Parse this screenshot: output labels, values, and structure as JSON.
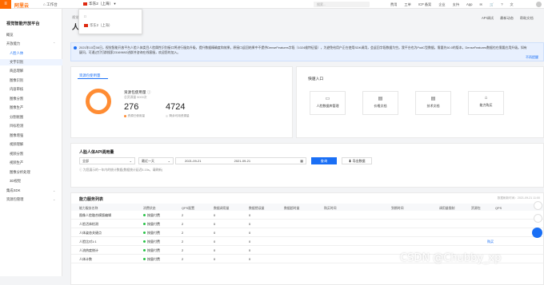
{
  "topbar": {
    "brand": "阿里云",
    "workbench": "工作台",
    "region": "华东2（上海）",
    "search_placeholder": "搜索...",
    "links": [
      "费用",
      "工单",
      "ICP 备案",
      "企业",
      "支持",
      "App"
    ]
  },
  "region_dropdown": {
    "items": [
      "华东2（上海）"
    ]
  },
  "sidebar": {
    "title": "视觉智能开放平台",
    "items": [
      {
        "label": "概览",
        "type": "group"
      },
      {
        "label": "开放能力",
        "type": "group"
      },
      {
        "label": "人脸人体",
        "type": "item"
      },
      {
        "label": "文字识别",
        "type": "item"
      },
      {
        "label": "商品理解",
        "type": "item"
      },
      {
        "label": "图像识别",
        "type": "item"
      },
      {
        "label": "内容审核",
        "type": "item"
      },
      {
        "label": "图像分割",
        "type": "item"
      },
      {
        "label": "图像生产",
        "type": "item"
      },
      {
        "label": "分割抠图",
        "type": "item"
      },
      {
        "label": "目标检测",
        "type": "item"
      },
      {
        "label": "图像增强",
        "type": "item"
      },
      {
        "label": "视频理解",
        "type": "item"
      },
      {
        "label": "视频分割",
        "type": "item"
      },
      {
        "label": "视频生产",
        "type": "item"
      },
      {
        "label": "图像分析处理",
        "type": "item"
      },
      {
        "label": "3D视觉",
        "type": "item"
      },
      {
        "label": "集成SDK",
        "type": "group"
      },
      {
        "label": "资源包管理",
        "type": "group"
      }
    ]
  },
  "header": {
    "breadcrumb": "视觉智能开放平台 / 人脸人体",
    "title": "人脸人体",
    "links": [
      "API调试",
      "最新动态",
      "帮助文档"
    ]
  },
  "notice": {
    "text": "2021年10月08日，视觉智能开放平台人脸人体类目人脸属性识别接口将进行服务升级，提升数据精确度和效果，原接口返回结果中不提供DenseFeatures字段（1024维特征值），为避免给用户正在使用SDK调用，会返回字段数据为空。我平台也为PodC型数据，需要先50.0的版本，DenseFeatures数据也在需要应用升级。如有疑问，可通过钉钉群搜索23169692进群并咨询在线客服，欢迎您的加入。",
    "more": "不再提醒"
  },
  "usage": {
    "tab": "资源包使用量",
    "title": "资源包使用量",
    "subtitle": "总资源量 5000次",
    "used": "276",
    "remaining": "4724",
    "used_label": "资源已使用量",
    "remain_label": "剩余可用资源量"
  },
  "quick": {
    "title": "快速入口",
    "entries": [
      "人脸数据库管理",
      "价格文档",
      "技术文档",
      "能力购买"
    ]
  },
  "query": {
    "title": "人脸人体API调用量",
    "select_all": "全部",
    "range": "最近一天",
    "start": "2021-09-21",
    "end": "2021-09-21",
    "query_btn": "查询",
    "export_btn": "导出数据",
    "hint": "为您展示的一年内的统计数据(数据统计延迟5-15s，请刷新)"
  },
  "list": {
    "title": "能力服务列表",
    "timestamp": "数据刷新时间：2021-09-21 11:00",
    "headers": [
      "能力服务名称",
      "消费状态",
      "QPS配置",
      "数据调用量",
      "数据错误量",
      "数据超时量",
      "购买时间",
      "到期时间",
      "调用量限制",
      "资源包",
      "QPS"
    ],
    "rows": [
      {
        "name": "图像人脸融合模版编辑",
        "status": "按量付费",
        "qps": "2",
        "calls": "0",
        "errors": "0"
      },
      {
        "name": "人脸活体检测",
        "status": "按量付费",
        "qps": "2",
        "calls": "0",
        "errors": "0"
      },
      {
        "name": "人体姿态关键点",
        "status": "按量付费",
        "qps": "2",
        "calls": "0",
        "errors": "0"
      },
      {
        "name": "人脸比对1:1",
        "status": "按量付费",
        "qps": "2",
        "calls": "0",
        "errors": "0"
      },
      {
        "name": "人流热度统计",
        "status": "按量付费",
        "qps": "2",
        "calls": "0",
        "errors": "0"
      },
      {
        "name": "人体计数",
        "status": "按量付费",
        "qps": "2",
        "calls": "0",
        "errors": "0"
      }
    ],
    "buy_label": "购买"
  },
  "watermark": "CSDN @Chubby_xp",
  "colors": {
    "accent": "#1a6ff5",
    "brand": "#ff6a00",
    "ring": "#ff8c33"
  }
}
